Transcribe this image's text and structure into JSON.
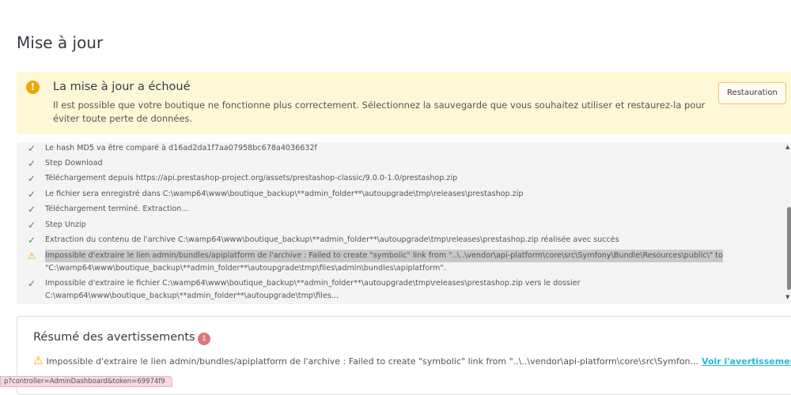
{
  "page": {
    "title": "Mise à jour"
  },
  "alert": {
    "icon": "exclamation-icon",
    "title": "La mise à jour a échoué",
    "message": "Il est possible que votre boutique ne fonctionne plus correctement. Sélectionnez la sauvegarde que vous souhaitez utiliser et restaurez-la pour éviter toute perte de données.",
    "button": "Restauration"
  },
  "log": [
    {
      "status": "success",
      "text": "Le hash MD5 va être comparé à d16ad2da1f7aa07958bc678a4036632f"
    },
    {
      "status": "success",
      "text": "Step Download"
    },
    {
      "status": "success",
      "text": "Téléchargement depuis https://api.prestashop-project.org/assets/prestashop-classic/9.0.0-1.0/prestashop.zip"
    },
    {
      "status": "success",
      "text": "Le fichier sera enregistré dans C:\\wamp64\\www\\boutique_backup\\**admin_folder**\\autoupgrade\\tmp\\releases\\prestashop.zip"
    },
    {
      "status": "success",
      "text": "Téléchargement terminé. Extraction..."
    },
    {
      "status": "success",
      "text": "Step Unzip"
    },
    {
      "status": "success",
      "text": "Extraction du contenu de l'archive C:\\wamp64\\www\\boutique_backup\\**admin_folder**\\autoupgrade\\tmp\\releases\\prestashop.zip réalisée avec succès"
    },
    {
      "status": "warning",
      "text": "Impossible d'extraire le lien admin/bundles/apiplatform de l'archive : Failed to create \"symbolic\" link from \"..\\..\\vendor\\api-platform\\core\\src\\Symfony\\Bundle\\Resources\\public\\\" to",
      "text2": "\"C:\\wamp64\\www\\boutique_backup\\**admin_folder**\\autoupgrade\\tmp\\files\\admin\\bundles\\apiplatform\"."
    },
    {
      "status": "success",
      "text": "Impossible d'extraire le fichier C:\\wamp64\\www\\boutique_backup\\**admin_folder**\\autoupgrade\\tmp\\releases\\prestashop.zip vers le dossier",
      "text2": "C:\\wamp64\\www\\boutique_backup\\**admin_folder**\\autoupgrade\\tmp\\files..."
    }
  ],
  "summary": {
    "title": "Résumé des avertissements",
    "count": "1",
    "warning": "Impossible d'extraire le lien admin/bundles/apiplatform de l'archive : Failed to create \"symbolic\" link from \"..\\..\\vendor\\api-platform\\core\\src\\Symfon...",
    "link": "Voir l'avertissement"
  },
  "statusbar": {
    "url": "p?controller=AdminDashboard&token=69974f9"
  }
}
